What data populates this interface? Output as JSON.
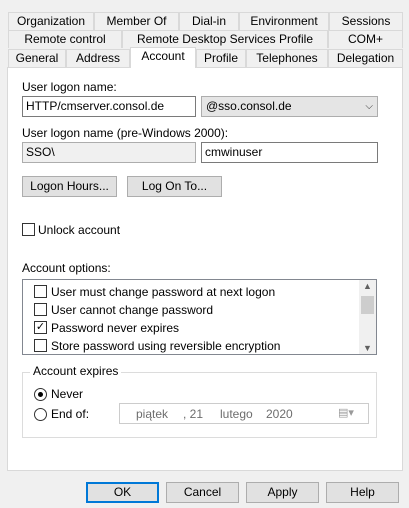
{
  "tabs": {
    "row1": [
      "Organization",
      "Member Of",
      "Dial-in",
      "Environment",
      "Sessions"
    ],
    "row2": [
      "Remote control",
      "Remote Desktop Services Profile",
      "COM+"
    ],
    "row3": [
      "General",
      "Address",
      "Account",
      "Profile",
      "Telephones",
      "Delegation"
    ],
    "active": "Account"
  },
  "logon": {
    "label": "User logon name:",
    "value": "HTTP/cmserver.consol.de",
    "domain": "@sso.consol.de"
  },
  "pre2000": {
    "label": "User logon name (pre-Windows 2000):",
    "domain": "SSO\\",
    "value": "cmwinuser"
  },
  "buttons": {
    "logon_hours": "Logon Hours...",
    "log_on_to": "Log On To..."
  },
  "unlock": {
    "label": "Unlock account",
    "checked": false
  },
  "options": {
    "label": "Account options:",
    "items": [
      {
        "label": "User must change password at next logon",
        "checked": false
      },
      {
        "label": "User cannot change password",
        "checked": false
      },
      {
        "label": "Password never expires",
        "checked": true
      },
      {
        "label": "Store password using reversible encryption",
        "checked": false
      }
    ]
  },
  "expires": {
    "label": "Account expires",
    "never": "Never",
    "end_of": "End of:",
    "selected": "never",
    "date": {
      "weekday": "piątek",
      "day": ", 21",
      "month": "lutego",
      "year": "2020"
    }
  },
  "dialog": {
    "ok": "OK",
    "cancel": "Cancel",
    "apply": "Apply",
    "help": "Help"
  }
}
